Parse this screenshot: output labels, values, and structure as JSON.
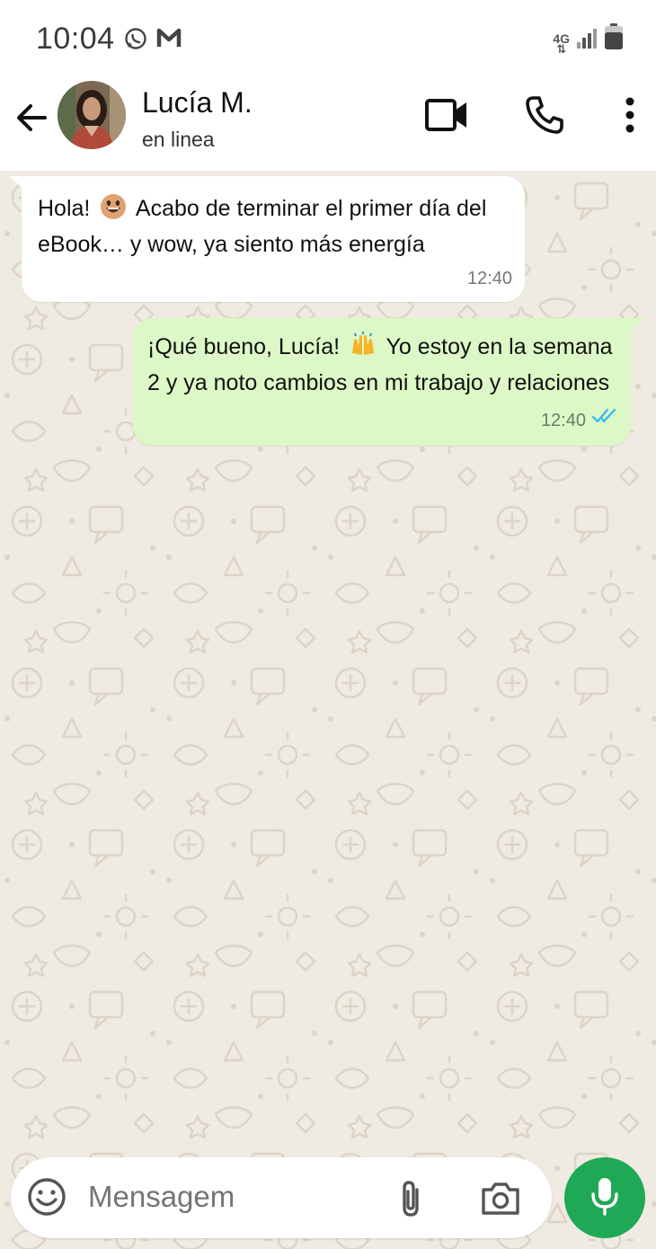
{
  "status_bar": {
    "time": "10:04",
    "network": "4G",
    "icons": [
      "whatsapp-icon",
      "gmail-icon",
      "signal-icon",
      "battery-icon"
    ]
  },
  "header": {
    "contact_name": "Lucía M.",
    "presence": "en linea",
    "icons": [
      "back-arrow-icon",
      "video-call-icon",
      "phone-icon",
      "more-options-icon"
    ]
  },
  "messages": [
    {
      "direction": "incoming",
      "text_before_emoji": "Hola!",
      "emoji": "grinning-face-icon",
      "text_after_emoji": "Acabo de terminar el primer día del eBook… y wow, ya siento más energía",
      "time": "12:40"
    },
    {
      "direction": "outgoing",
      "text_before_emoji": "¡Qué bueno, Lucía!",
      "emoji": "raising-hands-icon",
      "text_after_emoji": "Yo estoy en la semana 2 y ya noto cambios en mi trabajo y relaciones",
      "time": "12:40",
      "status": "read"
    }
  ],
  "composer": {
    "placeholder": "Mensagem",
    "icons": [
      "emoji-icon",
      "attach-icon",
      "camera-icon",
      "microphone-icon"
    ]
  },
  "colors": {
    "accent": "#1fa855",
    "outgoing_bubble": "#dcf8c6",
    "incoming_bubble": "#ffffff",
    "chat_background": "#efeae2",
    "read_ticks": "#34b7f1"
  }
}
